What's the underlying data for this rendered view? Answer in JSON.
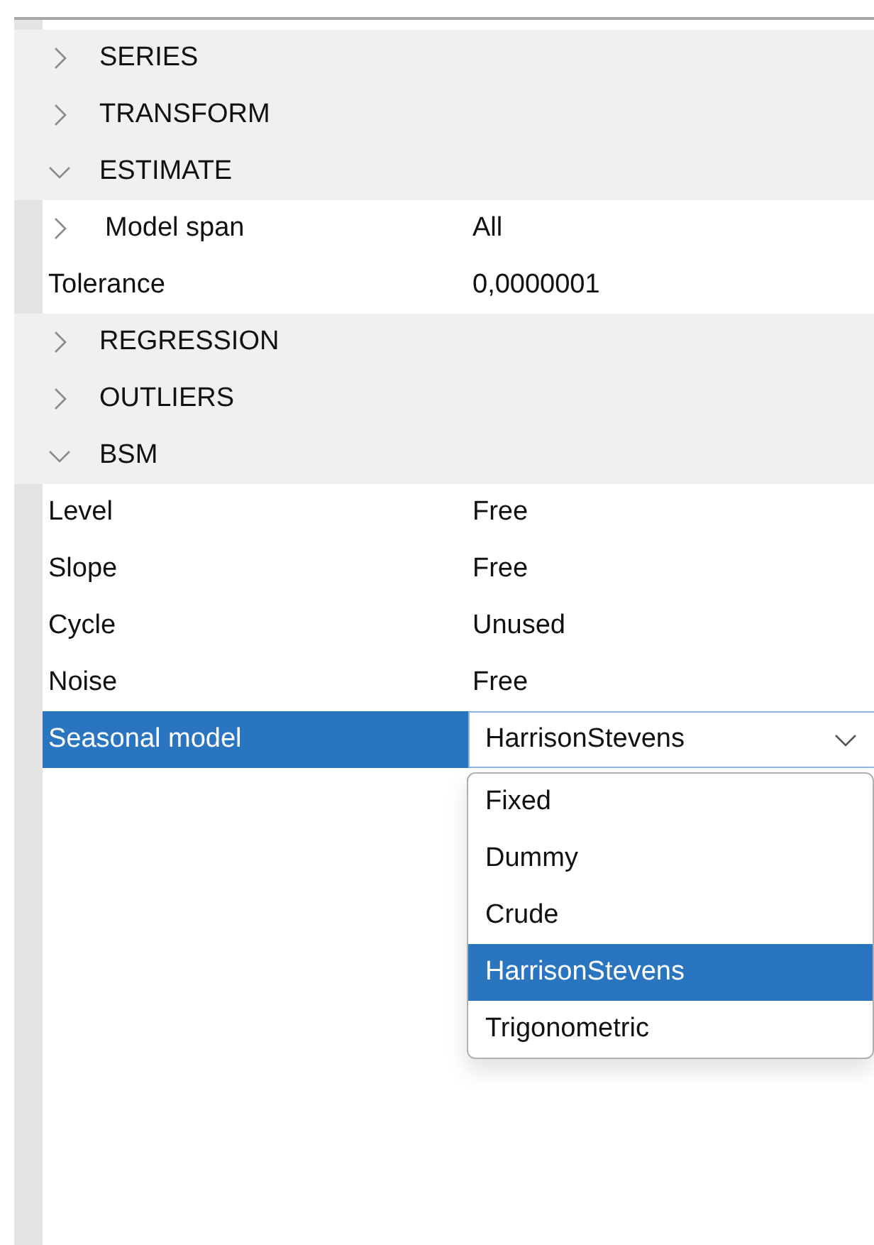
{
  "sections": [
    {
      "label": "SERIES",
      "expanded": false
    },
    {
      "label": "TRANSFORM",
      "expanded": false
    },
    {
      "label": "ESTIMATE",
      "expanded": true,
      "properties": [
        {
          "name": "Model span",
          "value": "All",
          "kind": "group",
          "expanded": false,
          "selected": false
        },
        {
          "name": "Tolerance",
          "value": "0,0000001",
          "kind": "text",
          "selected": false
        }
      ]
    },
    {
      "label": "REGRESSION",
      "expanded": false
    },
    {
      "label": "OUTLIERS",
      "expanded": false
    },
    {
      "label": "BSM",
      "expanded": true,
      "properties": [
        {
          "name": "Level",
          "value": "Free",
          "kind": "text",
          "selected": false
        },
        {
          "name": "Slope",
          "value": "Free",
          "kind": "text",
          "selected": false
        },
        {
          "name": "Cycle",
          "value": "Unused",
          "kind": "text",
          "selected": false
        },
        {
          "name": "Noise",
          "value": "Free",
          "kind": "text",
          "selected": false
        },
        {
          "name": "Seasonal model",
          "value": "HarrisonStevens",
          "kind": "dropdown",
          "selected": true,
          "open": true,
          "options": [
            {
              "label": "Fixed",
              "selected": false
            },
            {
              "label": "Dummy",
              "selected": false
            },
            {
              "label": "Crude",
              "selected": false
            },
            {
              "label": "HarrisonStevens",
              "selected": true
            },
            {
              "label": "Trigonometric",
              "selected": false
            }
          ]
        }
      ]
    }
  ]
}
